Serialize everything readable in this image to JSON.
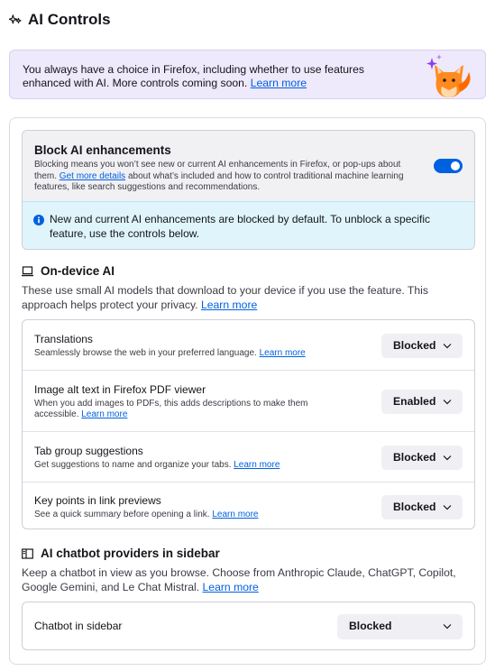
{
  "page": {
    "title": "AI Controls",
    "title_icon": "sparkle-icon"
  },
  "notice": {
    "text": "You always have a choice in Firefox, including whether to use features enhanced with AI. More controls coming soon.",
    "link": "Learn more",
    "mascot": "firefox-fox-mascot"
  },
  "block_ai": {
    "title": "Block AI enhancements",
    "desc_before": "Blocking means you won’t see new or current AI enhancements in Firefox, or pop-ups about them.",
    "desc_link": "Get more details",
    "desc_after": "about what’s included and how to control traditional machine learning features, like search suggestions and recommendations.",
    "toggle_on": true,
    "accent_color": "#0061e0",
    "info_text": "New and current AI enhancements are blocked by default. To unblock a specific feature, use the controls below.",
    "info_icon": "info-icon"
  },
  "on_device": {
    "title": "On-device AI",
    "icon": "laptop-icon",
    "desc": "These use small AI models that download to your device if you use the feature. This approach helps protect your privacy.",
    "link": "Learn more",
    "features": [
      {
        "title": "Translations",
        "desc": "Seamlessly browse the web in your preferred language.",
        "link": "Learn more",
        "value": "Blocked"
      },
      {
        "title": "Image alt text in Firefox PDF viewer",
        "desc": "When you add images to PDFs, this adds descriptions to make them accessible.",
        "link": "Learn more",
        "value": "Enabled"
      },
      {
        "title": "Tab group suggestions",
        "desc": "Get suggestions to name and organize your tabs.",
        "link": "Learn more",
        "value": "Blocked"
      },
      {
        "title": "Key points in link previews",
        "desc": "See a quick summary before opening a link.",
        "link": "Learn more",
        "value": "Blocked"
      }
    ]
  },
  "chatbot": {
    "title": "AI chatbot providers in sidebar",
    "icon": "sidebar-icon",
    "desc": "Keep a chatbot in view as you browse. Choose from Anthropic Claude, ChatGPT, Copilot, Google Gemini, and Le Chat Mistral.",
    "link": "Learn more",
    "row_label": "Chatbot in sidebar",
    "value": "Blocked"
  }
}
